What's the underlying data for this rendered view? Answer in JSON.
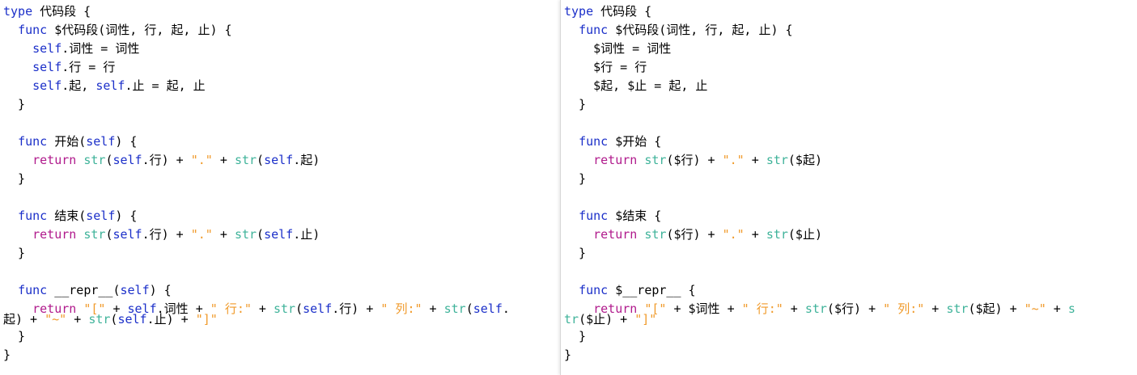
{
  "colors": {
    "keyword": "#1b2fc9",
    "return": "#b01a8c",
    "builtin": "#3fb39a",
    "string": "#f09a2a",
    "text": "#000000"
  },
  "left": {
    "lines": [
      [
        [
          "k",
          "type"
        ],
        [
          "p",
          " 代码段 {"
        ]
      ],
      [
        [
          "p",
          "  "
        ],
        [
          "k",
          "func"
        ],
        [
          "p",
          " $代码段(词性, 行, 起, 止) {"
        ]
      ],
      [
        [
          "p",
          "    "
        ],
        [
          "k",
          "self"
        ],
        [
          "p",
          ".词性 = 词性"
        ]
      ],
      [
        [
          "p",
          "    "
        ],
        [
          "k",
          "self"
        ],
        [
          "p",
          ".行 = 行"
        ]
      ],
      [
        [
          "p",
          "    "
        ],
        [
          "k",
          "self"
        ],
        [
          "p",
          ".起, "
        ],
        [
          "k",
          "self"
        ],
        [
          "p",
          ".止 = 起, 止"
        ]
      ],
      [
        [
          "p",
          "  }"
        ]
      ],
      [
        [
          "p",
          ""
        ]
      ],
      [
        [
          "p",
          "  "
        ],
        [
          "k",
          "func"
        ],
        [
          "p",
          " 开始("
        ],
        [
          "k",
          "self"
        ],
        [
          "p",
          ") {"
        ]
      ],
      [
        [
          "p",
          "    "
        ],
        [
          "r",
          "return"
        ],
        [
          "p",
          " "
        ],
        [
          "b",
          "str"
        ],
        [
          "p",
          "("
        ],
        [
          "k",
          "self"
        ],
        [
          "p",
          ".行) + "
        ],
        [
          "s",
          "\".\""
        ],
        [
          "p",
          " + "
        ],
        [
          "b",
          "str"
        ],
        [
          "p",
          "("
        ],
        [
          "k",
          "self"
        ],
        [
          "p",
          ".起)"
        ]
      ],
      [
        [
          "p",
          "  }"
        ]
      ],
      [
        [
          "p",
          ""
        ]
      ],
      [
        [
          "p",
          "  "
        ],
        [
          "k",
          "func"
        ],
        [
          "p",
          " 结束("
        ],
        [
          "k",
          "self"
        ],
        [
          "p",
          ") {"
        ]
      ],
      [
        [
          "p",
          "    "
        ],
        [
          "r",
          "return"
        ],
        [
          "p",
          " "
        ],
        [
          "b",
          "str"
        ],
        [
          "p",
          "("
        ],
        [
          "k",
          "self"
        ],
        [
          "p",
          ".行) + "
        ],
        [
          "s",
          "\".\""
        ],
        [
          "p",
          " + "
        ],
        [
          "b",
          "str"
        ],
        [
          "p",
          "("
        ],
        [
          "k",
          "self"
        ],
        [
          "p",
          ".止)"
        ]
      ],
      [
        [
          "p",
          "  }"
        ]
      ],
      [
        [
          "p",
          ""
        ]
      ],
      [
        [
          "p",
          "  "
        ],
        [
          "k",
          "func"
        ],
        [
          "p",
          " __repr__("
        ],
        [
          "k",
          "self"
        ],
        [
          "p",
          ") {"
        ]
      ],
      [
        [
          "p",
          "    "
        ],
        [
          "r",
          "return"
        ],
        [
          "p",
          " "
        ],
        [
          "s",
          "\"[\""
        ],
        [
          "p",
          " + "
        ],
        [
          "k",
          "self"
        ],
        [
          "p",
          ".词性 + "
        ],
        [
          "s",
          "\" 行:\""
        ],
        [
          "p",
          " + "
        ],
        [
          "b",
          "str"
        ],
        [
          "p",
          "("
        ],
        [
          "k",
          "self"
        ],
        [
          "p",
          ".行) + "
        ],
        [
          "s",
          "\" 列:\""
        ],
        [
          "p",
          " + "
        ],
        [
          "b",
          "str"
        ],
        [
          "p",
          "("
        ],
        [
          "k",
          "self"
        ],
        [
          "p",
          "."
        ]
      ],
      [
        [
          "p",
          "起) + "
        ],
        [
          "s",
          "\"~\""
        ],
        [
          "p",
          " + "
        ],
        [
          "b",
          "str"
        ],
        [
          "p",
          "("
        ],
        [
          "k",
          "self"
        ],
        [
          "p",
          ".止) + "
        ],
        [
          "s",
          "\"]\""
        ]
      ],
      [
        [
          "p",
          "  }"
        ]
      ],
      [
        [
          "p",
          "}"
        ]
      ]
    ]
  },
  "right": {
    "lines": [
      [
        [
          "k",
          "type"
        ],
        [
          "p",
          " 代码段 {"
        ]
      ],
      [
        [
          "p",
          "  "
        ],
        [
          "k",
          "func"
        ],
        [
          "p",
          " $代码段(词性, 行, 起, 止) {"
        ]
      ],
      [
        [
          "p",
          "    $词性 = 词性"
        ]
      ],
      [
        [
          "p",
          "    $行 = 行"
        ]
      ],
      [
        [
          "p",
          "    $起, $止 = 起, 止"
        ]
      ],
      [
        [
          "p",
          "  }"
        ]
      ],
      [
        [
          "p",
          ""
        ]
      ],
      [
        [
          "p",
          "  "
        ],
        [
          "k",
          "func"
        ],
        [
          "p",
          " $开始 {"
        ]
      ],
      [
        [
          "p",
          "    "
        ],
        [
          "r",
          "return"
        ],
        [
          "p",
          " "
        ],
        [
          "b",
          "str"
        ],
        [
          "p",
          "($行) + "
        ],
        [
          "s",
          "\".\""
        ],
        [
          "p",
          " + "
        ],
        [
          "b",
          "str"
        ],
        [
          "p",
          "($起)"
        ]
      ],
      [
        [
          "p",
          "  }"
        ]
      ],
      [
        [
          "p",
          ""
        ]
      ],
      [
        [
          "p",
          "  "
        ],
        [
          "k",
          "func"
        ],
        [
          "p",
          " $结束 {"
        ]
      ],
      [
        [
          "p",
          "    "
        ],
        [
          "r",
          "return"
        ],
        [
          "p",
          " "
        ],
        [
          "b",
          "str"
        ],
        [
          "p",
          "($行) + "
        ],
        [
          "s",
          "\".\""
        ],
        [
          "p",
          " + "
        ],
        [
          "b",
          "str"
        ],
        [
          "p",
          "($止)"
        ]
      ],
      [
        [
          "p",
          "  }"
        ]
      ],
      [
        [
          "p",
          ""
        ]
      ],
      [
        [
          "p",
          "  "
        ],
        [
          "k",
          "func"
        ],
        [
          "p",
          " $__repr__ {"
        ]
      ],
      [
        [
          "p",
          "    "
        ],
        [
          "r",
          "return"
        ],
        [
          "p",
          " "
        ],
        [
          "s",
          "\"[\""
        ],
        [
          "p",
          " + $词性 + "
        ],
        [
          "s",
          "\" 行:\""
        ],
        [
          "p",
          " + "
        ],
        [
          "b",
          "str"
        ],
        [
          "p",
          "($行) + "
        ],
        [
          "s",
          "\" 列:\""
        ],
        [
          "p",
          " + "
        ],
        [
          "b",
          "str"
        ],
        [
          "p",
          "($起) + "
        ],
        [
          "s",
          "\"~\""
        ],
        [
          "p",
          " + "
        ],
        [
          "b",
          "s"
        ]
      ],
      [
        [
          "b",
          "tr"
        ],
        [
          "p",
          "($止) + "
        ],
        [
          "s",
          "\"]\""
        ]
      ],
      [
        [
          "p",
          "  }"
        ]
      ],
      [
        [
          "p",
          "}"
        ]
      ]
    ]
  }
}
